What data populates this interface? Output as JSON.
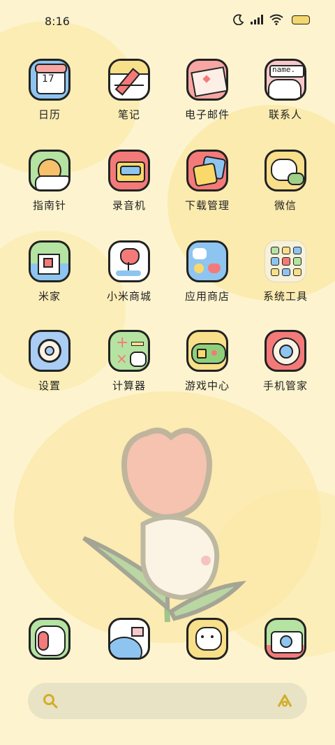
{
  "status_bar": {
    "time": "8:16",
    "icons": [
      "moon-icon",
      "signal-icon",
      "wifi-icon",
      "battery-icon"
    ],
    "accent_color": "#f3d66e"
  },
  "apps": [
    {
      "name": "calendar",
      "label": "日历",
      "icon": "calendar-icon",
      "color": "#8ec5f0",
      "badge": "17"
    },
    {
      "name": "notes",
      "label": "笔记",
      "icon": "notes-icon",
      "color": "#f8df8a"
    },
    {
      "name": "email",
      "label": "电子邮件",
      "icon": "email-icon",
      "color": "#f7a6a3"
    },
    {
      "name": "contacts",
      "label": "联系人",
      "icon": "contacts-icon",
      "color": "#f7c7c9",
      "tag": "name."
    },
    {
      "name": "compass",
      "label": "指南针",
      "icon": "compass-icon",
      "color": "#b5e3a2"
    },
    {
      "name": "recorder",
      "label": "录音机",
      "icon": "recorder-icon",
      "color": "#f47a7a"
    },
    {
      "name": "downloads",
      "label": "下载管理",
      "icon": "download-icon",
      "color": "#f47a7a"
    },
    {
      "name": "weibo",
      "label": "微信",
      "icon": "chat-icon",
      "color": "#f8df8a"
    },
    {
      "name": "mi-home",
      "label": "米家",
      "icon": "home-icon",
      "color": "#b5e3a2"
    },
    {
      "name": "mi-store",
      "label": "小米商城",
      "icon": "tulip-icon",
      "color": "#ffffff"
    },
    {
      "name": "app-store",
      "label": "应用商店",
      "icon": "store-icon",
      "color": "#8ec5f0"
    },
    {
      "name": "system-tools",
      "label": "系统工具",
      "icon": "folder-icon",
      "color": "#f7f1da"
    },
    {
      "name": "settings",
      "label": "设置",
      "icon": "gear-icon",
      "color": "#a9cdf3"
    },
    {
      "name": "calculator",
      "label": "计算器",
      "icon": "calculator-icon",
      "color": "#b5e3a2"
    },
    {
      "name": "game-center",
      "label": "游戏中心",
      "icon": "gamepad-icon",
      "color": "#f8df8a"
    },
    {
      "name": "security",
      "label": "手机管家",
      "icon": "shield-icon",
      "color": "#f47a7a"
    }
  ],
  "dock": [
    {
      "name": "phone",
      "icon": "phone-icon",
      "color": "#b5e3a2"
    },
    {
      "name": "browser",
      "icon": "globe-icon",
      "color": "#8ec5f0"
    },
    {
      "name": "messages",
      "icon": "cat-icon",
      "color": "#f8df8a"
    },
    {
      "name": "camera",
      "icon": "camera-icon",
      "color": "#b5e3a2"
    }
  ],
  "search": {
    "icon": "search-icon",
    "assistant_icon": "assistant-icon"
  }
}
